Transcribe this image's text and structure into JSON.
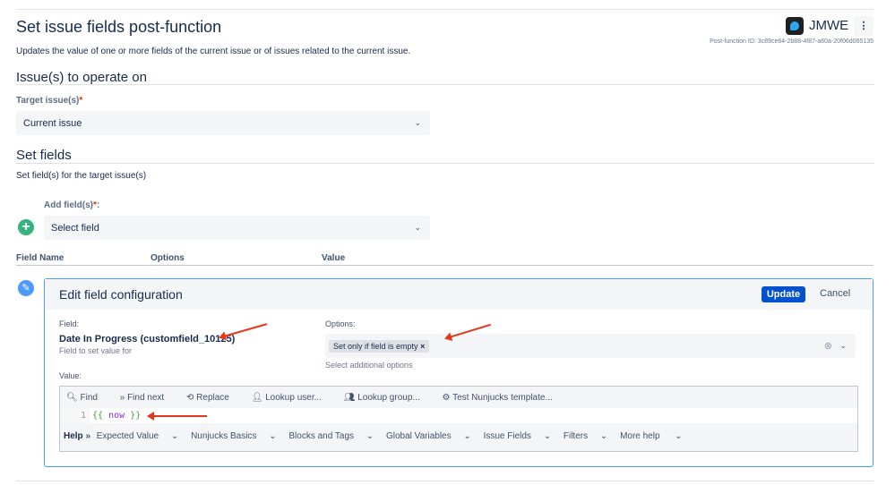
{
  "header": {
    "title": "Set issue fields post-function",
    "description": "Updates the value of one or more fields of the current issue or of issues related to the current issue.",
    "app_name": "JMWE",
    "post_function_id": "Post-function ID: 3c89ce64-2b88-4f87-a60a-20f06d065135"
  },
  "section1": {
    "title": "Issue(s) to operate on",
    "target_label": "Target issue(s)",
    "target_value": "Current issue"
  },
  "section2": {
    "title": "Set fields",
    "description": "Set field(s) for the target issue(s)",
    "add_label": "Add field(s)",
    "add_placeholder": "Select field",
    "columns": [
      "Field Name",
      "Options",
      "Value"
    ]
  },
  "required_mark": "*",
  "edit": {
    "title": "Edit field configuration",
    "update": "Update",
    "cancel": "Cancel",
    "field_label": "Field:",
    "field_value": "Date In Progress (customfield_10125)",
    "field_help": "Field to set value for",
    "options_label": "Options:",
    "option_tag": "Set only if field is empty",
    "options_help": "Select additional options",
    "value_label": "Value:"
  },
  "editor": {
    "toolbar": [
      "Find",
      "Find next",
      "Replace",
      "Lookup user...",
      "Lookup group...",
      "Test Nunjucks template..."
    ],
    "line_number": "1",
    "code_open": "{{",
    "code_var": "now",
    "code_close": "}}",
    "help_label": "Help",
    "help_menus": [
      "Expected Value",
      "Nunjucks Basics",
      "Blocks and Tags",
      "Global Variables",
      "Issue Fields",
      "Filters",
      "More help"
    ]
  },
  "colors": {
    "primary": "#0052cc",
    "arrow": "#e5381b",
    "add": "#36b37e"
  }
}
